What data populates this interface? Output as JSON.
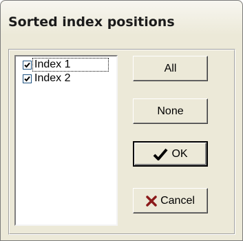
{
  "dialog": {
    "title": "Sorted index positions"
  },
  "list": {
    "items": [
      {
        "label": "Index 1",
        "checked": true
      },
      {
        "label": "Index 2",
        "checked": true
      }
    ]
  },
  "buttons": {
    "all_label": "All",
    "none_label": "None",
    "ok_label": "OK",
    "cancel_label": "Cancel"
  },
  "icons": {
    "ok": "checkmark-icon",
    "cancel": "x-mark-icon"
  },
  "colors": {
    "ok_icon": "#000000",
    "cancel_icon": "#8b1a1a",
    "dialog_background": "#ece9d8"
  }
}
